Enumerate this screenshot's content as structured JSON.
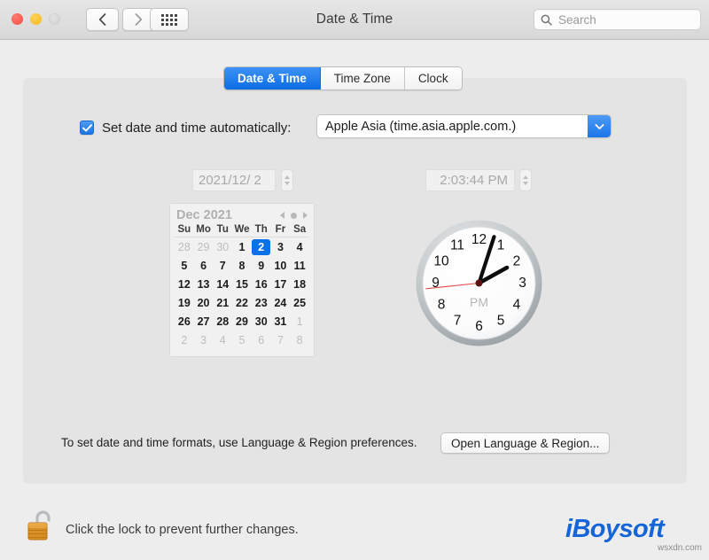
{
  "window": {
    "title": "Date & Time",
    "traffic_lights": [
      "close",
      "minimize",
      "zoom"
    ],
    "nav": {
      "back": "back-chevron",
      "forward": "forward-chevron",
      "show_all": "grid-icon"
    }
  },
  "search": {
    "placeholder": "Search",
    "value": "",
    "icon": "search-icon"
  },
  "tabs": [
    {
      "label": "Date & Time",
      "active": true
    },
    {
      "label": "Time Zone",
      "active": false
    },
    {
      "label": "Clock",
      "active": false
    }
  ],
  "auto_row": {
    "checkbox_checked": true,
    "label": "Set date and time automatically:",
    "server": "Apple Asia (time.asia.apple.com.)",
    "dropdown_icon": "chevron-down-icon",
    "accent_color": "#0d6ce4"
  },
  "date_field": {
    "value": "2021/12/ 2",
    "enabled": false
  },
  "time_field": {
    "value": "2:03:44 PM",
    "enabled": false
  },
  "calendar": {
    "month_label": "Dec 2021",
    "prev_icon": "triangle-left-icon",
    "today_icon": "dot-icon",
    "next_icon": "triangle-right-icon",
    "day_headers": [
      "Su",
      "Mo",
      "Tu",
      "We",
      "Th",
      "Fr",
      "Sa"
    ],
    "selected_day": 2,
    "selection_color": "#0a72e8",
    "weeks": [
      [
        {
          "d": "28",
          "muted": true
        },
        {
          "d": "29",
          "muted": true
        },
        {
          "d": "30",
          "muted": true
        },
        {
          "d": "1",
          "muted": false
        },
        {
          "d": "2",
          "muted": false,
          "selected": true
        },
        {
          "d": "3",
          "muted": false
        },
        {
          "d": "4",
          "muted": false
        }
      ],
      [
        {
          "d": "5",
          "muted": false
        },
        {
          "d": "6",
          "muted": false
        },
        {
          "d": "7",
          "muted": false
        },
        {
          "d": "8",
          "muted": false
        },
        {
          "d": "9",
          "muted": false
        },
        {
          "d": "10",
          "muted": false
        },
        {
          "d": "11",
          "muted": false
        }
      ],
      [
        {
          "d": "12",
          "muted": false
        },
        {
          "d": "13",
          "muted": false
        },
        {
          "d": "14",
          "muted": false
        },
        {
          "d": "15",
          "muted": false
        },
        {
          "d": "16",
          "muted": false
        },
        {
          "d": "17",
          "muted": false
        },
        {
          "d": "18",
          "muted": false
        }
      ],
      [
        {
          "d": "19",
          "muted": false
        },
        {
          "d": "20",
          "muted": false
        },
        {
          "d": "21",
          "muted": false
        },
        {
          "d": "22",
          "muted": false
        },
        {
          "d": "23",
          "muted": false
        },
        {
          "d": "24",
          "muted": false
        },
        {
          "d": "25",
          "muted": false
        }
      ],
      [
        {
          "d": "26",
          "muted": false
        },
        {
          "d": "27",
          "muted": false
        },
        {
          "d": "28",
          "muted": false
        },
        {
          "d": "29",
          "muted": false
        },
        {
          "d": "30",
          "muted": false
        },
        {
          "d": "31",
          "muted": false
        },
        {
          "d": "1",
          "muted": true
        }
      ],
      [
        {
          "d": "2",
          "muted": true
        },
        {
          "d": "3",
          "muted": true
        },
        {
          "d": "4",
          "muted": true
        },
        {
          "d": "5",
          "muted": true
        },
        {
          "d": "6",
          "muted": true
        },
        {
          "d": "7",
          "muted": true
        },
        {
          "d": "8",
          "muted": true
        }
      ]
    ]
  },
  "clock": {
    "meridiem": "PM",
    "hour_numerals": [
      "12",
      "1",
      "2",
      "3",
      "4",
      "5",
      "6",
      "7",
      "8",
      "9",
      "10",
      "11"
    ],
    "hour_hand_degrees": 61,
    "minute_hand_degrees": 18,
    "second_hand_degrees": 264,
    "second_hand_color": "#e04a4a",
    "face_color": "#ffffff",
    "bezel_color": "#a8aeb2"
  },
  "footer": {
    "hint": "To set date and time formats, use Language & Region preferences.",
    "button_label": "Open Language & Region..."
  },
  "lock_bar": {
    "icon": "unlocked-padlock-icon",
    "text": "Click the lock to prevent further changes."
  },
  "watermark": {
    "brand": "iBoysoft",
    "sub": "wsxdn.com",
    "brand_color": "#1565d8"
  }
}
